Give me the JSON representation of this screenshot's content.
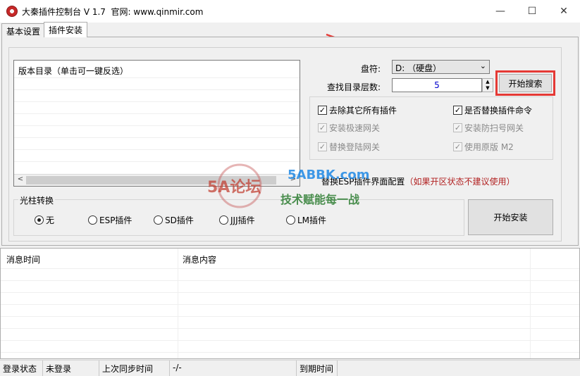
{
  "window": {
    "title": "大秦插件控制台 V 1.7  官网: www.qinmir.com",
    "controls": {
      "minimize": "—",
      "maximize": "☐",
      "close": "✕"
    }
  },
  "tabs": [
    {
      "label": "基本设置",
      "active": false
    },
    {
      "label": "插件安装",
      "active": true
    }
  ],
  "directory_list": {
    "header": "版本目录（单击可一键反选）",
    "scroll_left": "<",
    "scroll_right": ">"
  },
  "drive": {
    "label": "盘符:",
    "value": "D: （硬盘）"
  },
  "depth": {
    "label": "查找目录层数:",
    "value": "5"
  },
  "search_button": "开始搜索",
  "options": [
    {
      "label": "去除其它所有插件",
      "checked": true,
      "enabled": true
    },
    {
      "label": "是否替换插件命令",
      "checked": true,
      "enabled": true
    },
    {
      "label": "安装极速网关",
      "checked": true,
      "enabled": false
    },
    {
      "label": "安装防扫号网关",
      "checked": true,
      "enabled": false
    },
    {
      "label": "替换登陆网关",
      "checked": true,
      "enabled": false
    },
    {
      "label": "使用原版 M2",
      "checked": true,
      "enabled": false
    }
  ],
  "esp_config": {
    "prefix": "替换ESP插件界面配置",
    "warning": "（如果开区状态不建议使用）"
  },
  "bar_group": {
    "title": "光柱转换",
    "options": [
      {
        "label": "无",
        "selected": true
      },
      {
        "label": "ESP插件",
        "selected": false
      },
      {
        "label": "SD插件",
        "selected": false
      },
      {
        "label": "JJJ插件",
        "selected": false
      },
      {
        "label": "LM插件",
        "selected": false
      }
    ]
  },
  "install_button": "开始安装",
  "log": {
    "columns": [
      "消息时间",
      "消息内容"
    ]
  },
  "statusbar": {
    "login_label": "登录状态",
    "login_value": "未登录",
    "sync_label": "上次同步时间",
    "sync_value": "-/-",
    "expire_label": "到期时间"
  },
  "watermark": {
    "logo": "5A论坛",
    "brand": "5ABBK.com",
    "slogan": "技术赋能每一战"
  },
  "colors": {
    "highlight": "#e53935",
    "link_red": "#b22222",
    "value_blue": "#0000cc"
  }
}
